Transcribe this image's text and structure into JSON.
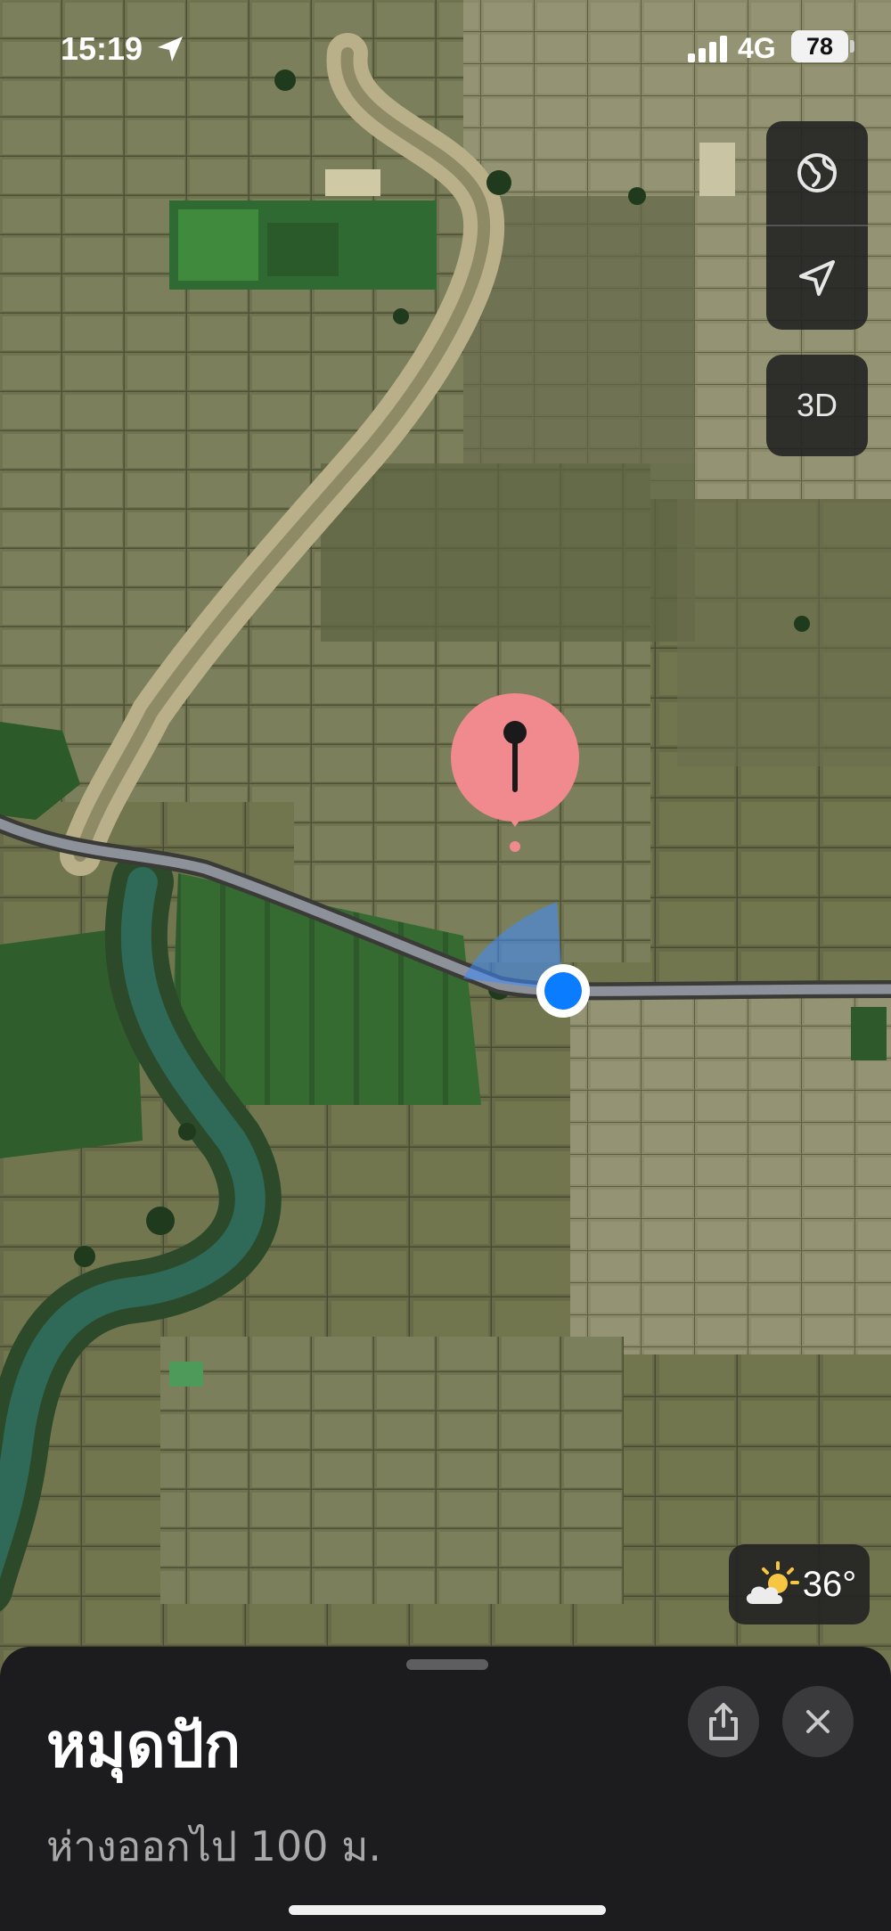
{
  "status_bar": {
    "time": "15:19",
    "network": "4G",
    "battery": "78",
    "location_icon": "location-arrow-icon",
    "signal_icon": "cellular-signal-icon"
  },
  "map": {
    "view": "satellite",
    "pin_color": "#f08a8e",
    "user_location_color": "#0a7cff",
    "pin_icon": "map-pin-icon"
  },
  "controls": {
    "globe_icon": "globe-icon",
    "tracking_icon": "location-tracking-icon",
    "three_d_label": "3D"
  },
  "weather": {
    "icon": "partly-sunny-icon",
    "temperature": "36°"
  },
  "sheet": {
    "title": "หมุดปัก",
    "subtitle": "ห่างออกไป 100 ม.",
    "share_icon": "share-icon",
    "close_icon": "close-icon"
  }
}
